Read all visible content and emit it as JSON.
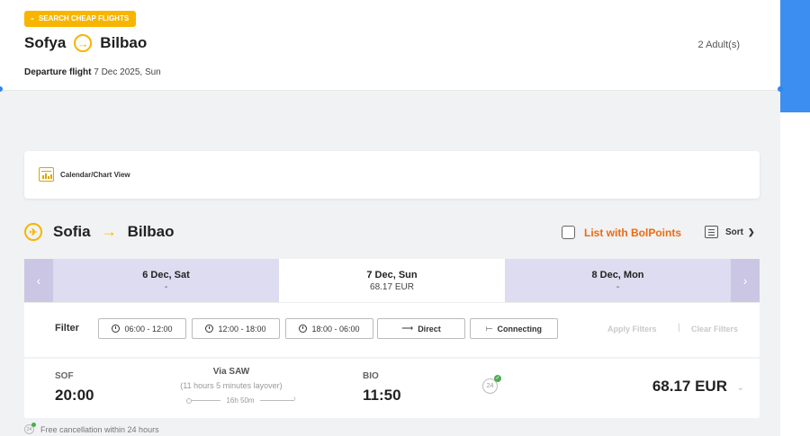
{
  "search_badge": "SEARCH CHEAP FLIGHTS",
  "route": {
    "from": "Sofya",
    "to": "Bilbao"
  },
  "passengers": "2 Adult(s)",
  "departure": {
    "label": "Departure flight",
    "date": "7 Dec 2025, Sun"
  },
  "view_toggle": "Calendar/Chart View",
  "section": {
    "from": "Sofia",
    "to": "Bilbao"
  },
  "bolpoints_label": "List with BolPoints",
  "sort_label": "Sort",
  "dates": [
    {
      "date": "6 Dec, Sat",
      "price": "-"
    },
    {
      "date": "7 Dec, Sun",
      "price": "68.17 EUR"
    },
    {
      "date": "8 Dec, Mon",
      "price": "-"
    }
  ],
  "filter": {
    "label": "Filter",
    "time_slots": [
      "06:00 - 12:00",
      "12:00 - 18:00",
      "18:00 - 06:00"
    ],
    "direct": "Direct",
    "connecting": "Connecting",
    "apply": "Apply Filters",
    "clear": "Clear Filters",
    "separator": "|"
  },
  "flight": {
    "dep_code": "SOF",
    "dep_time": "20:00",
    "via": "Via SAW",
    "layover": "(11 hours 5 minutes layover)",
    "duration": "16h 50m",
    "arr_code": "BIO",
    "arr_time": "11:50",
    "price": "68.17 EUR"
  },
  "free_cancellation": "Free cancellation within 24 hours",
  "colors": {
    "accent": "#f7b500",
    "orange": "#f06a0f",
    "blue": "#3c8ff0",
    "date_strip": "#dedcf0"
  }
}
